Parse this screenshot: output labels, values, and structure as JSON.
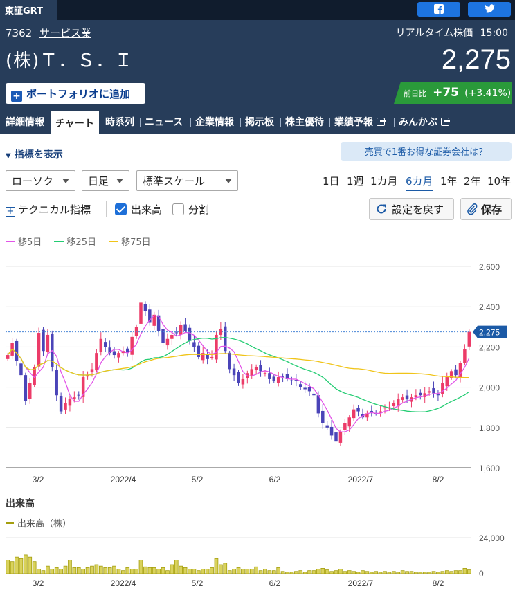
{
  "market": "東証GRT",
  "stock": {
    "code": "7362",
    "sector": "サービス業",
    "name": "(株)Ｔ．Ｓ．Ｉ",
    "realtime_label": "リアルタイム株価",
    "time": "15:00",
    "price": "2,275",
    "change_label": "前日比",
    "change": "+75",
    "change_pct": "(+3.41%)"
  },
  "portfolio_button": "ポートフォリオに追加",
  "nav": [
    "詳細情報",
    "チャート",
    "時系列",
    "ニュース",
    "企業情報",
    "掲示板",
    "株主優待",
    "業績予報",
    "みんかぶ"
  ],
  "nav_active": "チャート",
  "indicator_toggle": "指標を表示",
  "broker_button": "売買で1番お得な証券会社は？",
  "selects": {
    "chart_type": "ローソク",
    "interval": "日足",
    "scale": "標準スケール"
  },
  "periods": [
    "1日",
    "1週",
    "1カ月",
    "6カ月",
    "1年",
    "2年",
    "10年"
  ],
  "period_active": "6カ月",
  "technical_label": "テクニカル指標",
  "volume_checkbox": {
    "label": "出来高",
    "checked": true
  },
  "split_checkbox": {
    "label": "分割",
    "checked": false
  },
  "reset_button": "設定を戻す",
  "save_button": "保存",
  "legend": [
    {
      "label": "移5日",
      "color": "#e254e8"
    },
    {
      "label": "移25日",
      "color": "#22cc72"
    },
    {
      "label": "移75日",
      "color": "#f0c419"
    }
  ],
  "colors": {
    "up": "#ec3b68",
    "down": "#4a44b8",
    "volume": "#a49e0e",
    "accent": "#1b5aa6"
  },
  "chart_data": {
    "type": "candlestick",
    "y_ticks": [
      "2,600",
      "2,400",
      "2,200",
      "2,000",
      "1,800",
      "1,600"
    ],
    "ylim": [
      1600,
      2600
    ],
    "x_labels": [
      "3/2",
      "2022/4",
      "5/2",
      "6/2",
      "2022/7",
      "8/2"
    ],
    "last_price_label": "2,275",
    "last_price": 2275,
    "closes": [
      2160,
      2220,
      2130,
      2060,
      1930,
      2020,
      2100,
      2270,
      2180,
      2260,
      2100,
      1960,
      1880,
      1920,
      1940,
      1950,
      1960,
      2050,
      2060,
      2090,
      2170,
      2240,
      2200,
      2170,
      2160,
      2170,
      2180,
      2170,
      2250,
      2300,
      2420,
      2380,
      2320,
      2360,
      2280,
      2220,
      2240,
      2260,
      2270,
      2310,
      2280,
      2230,
      2200,
      2150,
      2170,
      2140,
      2150,
      2260,
      2290,
      2180,
      2090,
      2060,
      2020,
      2040,
      2070,
      2090,
      2100,
      2080,
      2070,
      2040,
      2030,
      2050,
      2050,
      2040,
      2030,
      2030,
      2000,
      1990,
      1980,
      1960,
      1870,
      1820,
      1800,
      1760,
      1730,
      1780,
      1820,
      1850,
      1890,
      1880,
      1850,
      1870,
      1880,
      1870,
      1880,
      1900,
      1900,
      1920,
      1940,
      1950,
      1940,
      1950,
      1960,
      1960,
      1970,
      1980,
      1970,
      1960,
      2020,
      2050,
      2080,
      2060,
      2120,
      2190,
      2275
    ],
    "volume_title": "出来高",
    "volume_legend": "出来高（株）",
    "volume_ticks": [
      "24,000",
      "0"
    ],
    "volume_max": 24000,
    "volumes": [
      9000,
      8000,
      11000,
      10000,
      12500,
      11000,
      8000,
      3000,
      2000,
      5000,
      3000,
      4000,
      3000,
      5000,
      9000,
      4000,
      4000,
      3000,
      4000,
      5000,
      6000,
      5000,
      4000,
      4000,
      5000,
      3000,
      2000,
      4000,
      3000,
      3000,
      9000,
      4500,
      4000,
      4000,
      3000,
      4000,
      2000,
      6000,
      9000,
      5000,
      4000,
      3000,
      3000,
      2000,
      3000,
      3000,
      4000,
      10000,
      6000,
      7000,
      2000,
      3000,
      4000,
      3000,
      3000,
      3000,
      4500,
      2000,
      3000,
      2000,
      2000,
      4000,
      1500,
      1000,
      1000,
      1500,
      2000,
      1000,
      2000,
      2000,
      3000,
      3500,
      2500,
      1500,
      2000,
      3000,
      1500,
      2000,
      1500,
      1000,
      2000,
      1500,
      1000,
      1500,
      1000,
      1500,
      1000,
      1500,
      1000,
      2000,
      1500,
      1500,
      1000,
      1000,
      1000,
      1000,
      1500,
      1000,
      1500,
      2000,
      1500,
      2000,
      2000,
      3500,
      2500
    ]
  }
}
